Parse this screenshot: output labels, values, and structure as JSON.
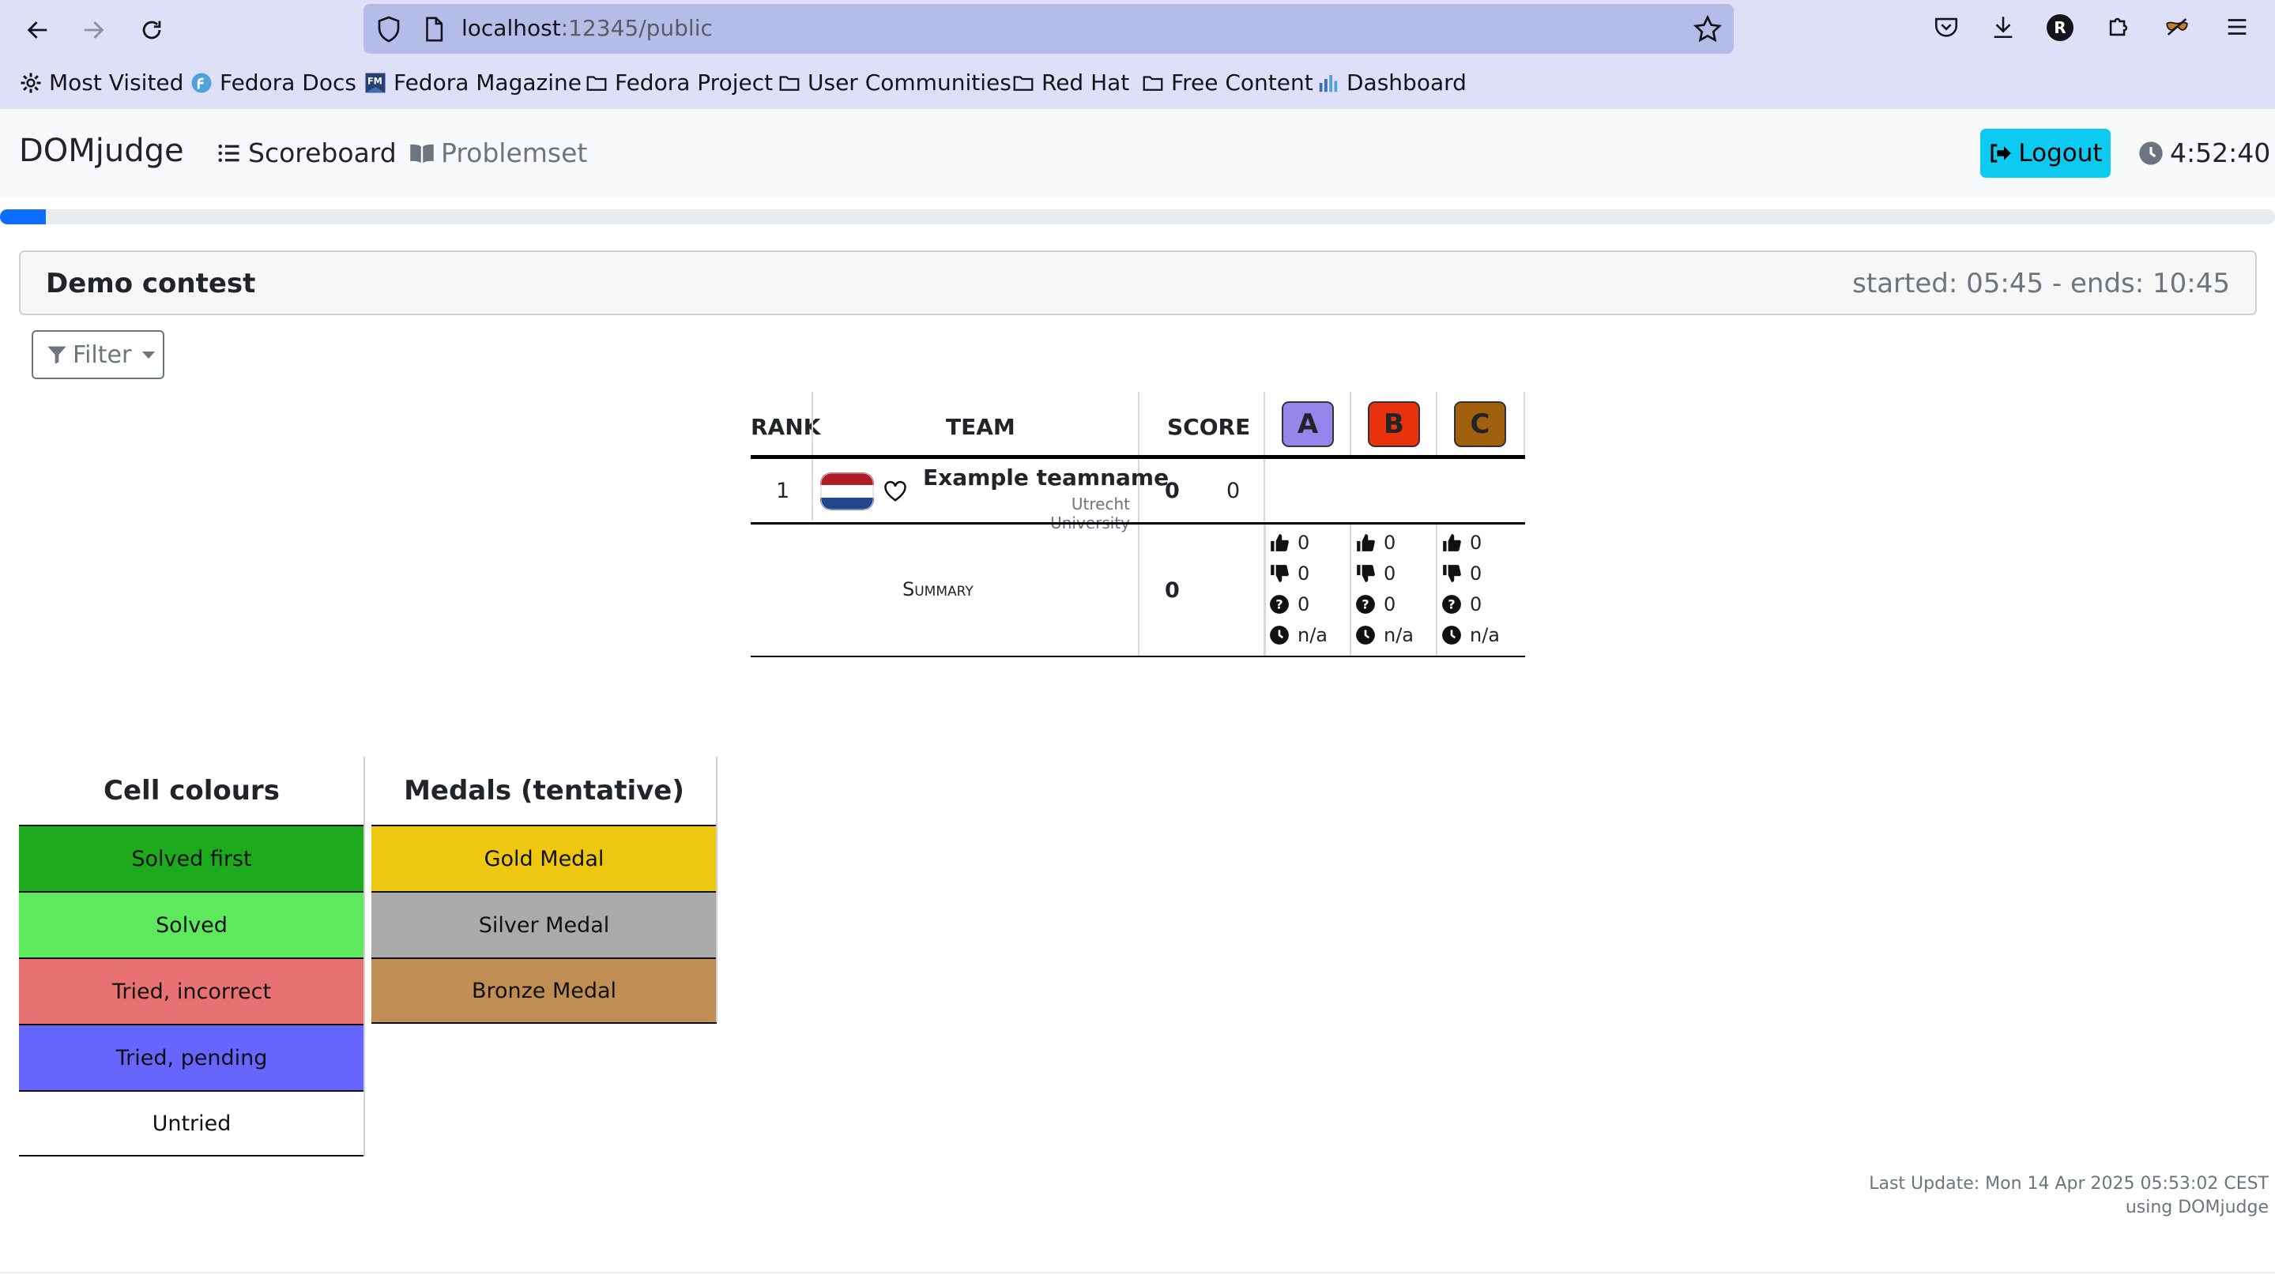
{
  "browser": {
    "url_host": "localhost",
    "url_rest": ":12345/public",
    "avatar_letter": "R",
    "bookmarks": [
      {
        "label": "Most Visited",
        "icon": "gear-icon"
      },
      {
        "label": "Fedora Docs",
        "icon": "fedora-icon"
      },
      {
        "label": "Fedora Magazine",
        "icon": "fm-icon"
      },
      {
        "label": "Fedora Project",
        "icon": "folder-icon"
      },
      {
        "label": "User Communities",
        "icon": "folder-icon"
      },
      {
        "label": "Red Hat",
        "icon": "folder-icon"
      },
      {
        "label": "Free Content",
        "icon": "folder-icon"
      },
      {
        "label": "Dashboard",
        "icon": "chart-icon"
      }
    ]
  },
  "navbar": {
    "brand": "DOMjudge",
    "scoreboard": "Scoreboard",
    "problemset": "Problemset",
    "logout": "Logout",
    "clock": "4:52:40",
    "progress_fraction": 0.02
  },
  "contest": {
    "name": "Demo contest",
    "times": "started: 05:45 - ends: 10:45"
  },
  "filter": {
    "label": "Filter"
  },
  "scoreboard": {
    "headers": {
      "rank": "RANK",
      "team": "TEAM",
      "score": "SCORE"
    },
    "problems": [
      {
        "label": "A",
        "color": "#9486ea"
      },
      {
        "label": "B",
        "color": "#e8330e"
      },
      {
        "label": "C",
        "color": "#a0600e"
      }
    ],
    "teams": [
      {
        "rank": "1",
        "name": "Example teamname",
        "affiliation": "Utrecht University",
        "points": "0",
        "penalty": "0"
      }
    ],
    "summary": {
      "label": "Summary",
      "score": "0",
      "problems": [
        {
          "correct": "0",
          "incorrect": "0",
          "pending": "0",
          "first": "n/a"
        },
        {
          "correct": "0",
          "incorrect": "0",
          "pending": "0",
          "first": "n/a"
        },
        {
          "correct": "0",
          "incorrect": "0",
          "pending": "0",
          "first": "n/a"
        }
      ]
    }
  },
  "legend_cells": {
    "title": "Cell colours",
    "items": [
      {
        "label": "Solved first",
        "color": "#1daa1d"
      },
      {
        "label": "Solved",
        "color": "#5ee85e"
      },
      {
        "label": "Tried, incorrect",
        "color": "#e87272"
      },
      {
        "label": "Tried, pending",
        "color": "#6666ff"
      },
      {
        "label": "Untried",
        "color": "#ffffff"
      }
    ]
  },
  "legend_medals": {
    "title": "Medals (tentative)",
    "items": [
      {
        "label": "Gold Medal",
        "color": "#eec710"
      },
      {
        "label": "Silver Medal",
        "color": "#aaaaaa"
      },
      {
        "label": "Bronze Medal",
        "color": "#c08e55"
      }
    ]
  },
  "footer": {
    "last_update": "Last Update: Mon 14 Apr 2025 05:53:02 CEST",
    "using": "using DOMjudge"
  }
}
